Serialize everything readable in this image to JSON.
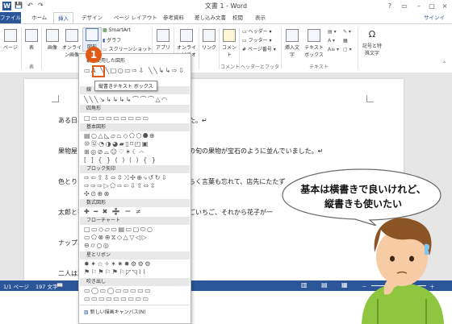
{
  "titlebar": {
    "app_icon": "W",
    "title": "文書 1 - Word",
    "quick_access": [
      "💾",
      "↶",
      "↷"
    ],
    "window_controls": [
      "?",
      "▭",
      "–",
      "□",
      "×"
    ],
    "user": "サインイ"
  },
  "tabs": [
    "ファイル",
    "ホーム",
    "挿入",
    "デザイン",
    "ページ レイアウト",
    "参考資料",
    "差し込み文書",
    "校閲",
    "表示"
  ],
  "active_tab": "挿入",
  "ribbon": {
    "groups": [
      {
        "label": "ページ",
        "buttons": [
          "ページ"
        ]
      },
      {
        "label": "表",
        "buttons": [
          "表"
        ]
      },
      {
        "label": "",
        "buttons": [
          "画像",
          "オンライン画像"
        ]
      },
      {
        "label": "",
        "buttons": [
          "図形"
        ]
      },
      {
        "label": "",
        "small": [
          "SmartArt",
          "グラフ",
          "スクリーンショット"
        ]
      },
      {
        "label": "",
        "buttons": [
          "アプリ"
        ]
      },
      {
        "label": "",
        "buttons": [
          "オンラインビデオ"
        ]
      },
      {
        "label": "",
        "buttons": [
          "リンク"
        ]
      },
      {
        "label": "コメント",
        "buttons": [
          "コメント"
        ]
      },
      {
        "label": "ヘッダーとフッター",
        "small": [
          "ヘッダー",
          "フッター",
          "ページ番号"
        ]
      },
      {
        "label": "テキスト",
        "buttons": [
          "挿入文字",
          "テキストボックス"
        ]
      },
      {
        "label": "",
        "buttons": [
          "記号と特殊文字"
        ]
      }
    ],
    "group_labels": [
      "表",
      "コメント",
      "ヘッダーとフッター",
      "テキスト"
    ],
    "ribbon_collapse_icon": "^"
  },
  "shapes_menu": {
    "top_label": "最近使用した図形",
    "tooltip": "縦書きテキスト ボックス",
    "categories": [
      "線",
      "四角形",
      "基本図形",
      "ブロック矢印",
      "数式図形",
      "フローチャート",
      "星とリボン",
      "吹き出し"
    ],
    "footer": "新しい描画キャンバス(N)"
  },
  "callout_number": "1",
  "document": {
    "paragraphs": [
      "ある日、",
      "果物屋さ",
      "色とりど",
      "太郎と花",
      "ナップル",
      "二人は次"
    ],
    "paragraph_tails": [
      "た。↵",
      "の旬の果物が宝石のように並んでいました。↵",
      "らく言葉も忘れて、店先にたたず",
      "ごいちご、それから花子が一",
      "",
      ""
    ]
  },
  "status": {
    "page": "1/1 ページ",
    "words": "197 文字",
    "view_icons": [
      "▥",
      "▤",
      "▦"
    ],
    "zoom_minus": "－",
    "zoom_plus": "＋"
  },
  "speech": {
    "line1": "基本は横書きで良いけれど、",
    "line2": "縦書きも使いたい"
  },
  "colors": {
    "word_blue": "#2b579a",
    "accent_orange": "#e15a16"
  }
}
